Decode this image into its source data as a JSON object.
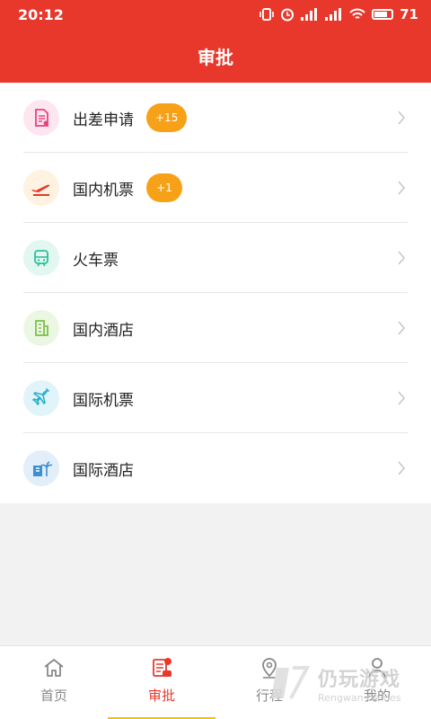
{
  "status_bar": {
    "time": "20:12",
    "battery": "71"
  },
  "header": {
    "title": "审批"
  },
  "list": {
    "items": [
      {
        "label": "出差申请",
        "badge": "+15",
        "icon": "document-icon",
        "color": "#e8427c",
        "bg": "#fde6ef"
      },
      {
        "label": "国内机票",
        "badge": "+1",
        "icon": "plane-takeoff-icon",
        "color": "#e8382b",
        "bg": "#fff2e0"
      },
      {
        "label": "火车票",
        "badge": "",
        "icon": "train-icon",
        "color": "#2fbf9a",
        "bg": "#e1f7f0"
      },
      {
        "label": "国内酒店",
        "badge": "",
        "icon": "building-icon",
        "color": "#7cc24a",
        "bg": "#ecf7e3"
      },
      {
        "label": "国际机票",
        "badge": "",
        "icon": "airplane-icon",
        "color": "#2bb0d1",
        "bg": "#e0f4fa"
      },
      {
        "label": "国际酒店",
        "badge": "",
        "icon": "hotel-palm-icon",
        "color": "#3b8fd4",
        "bg": "#e2eefa"
      }
    ]
  },
  "tabbar": {
    "tabs": [
      {
        "label": "首页",
        "icon": "home-icon"
      },
      {
        "label": "审批",
        "icon": "approval-icon",
        "active": true
      },
      {
        "label": "行程",
        "icon": "location-icon"
      },
      {
        "label": "我的",
        "icon": "user-icon"
      }
    ]
  },
  "watermark": {
    "main": "仍玩游戏",
    "sub": "Rengwan Games"
  },
  "colors": {
    "brand": "#e8382b",
    "badge": "#f7a119",
    "indicator": "#f3c300"
  }
}
